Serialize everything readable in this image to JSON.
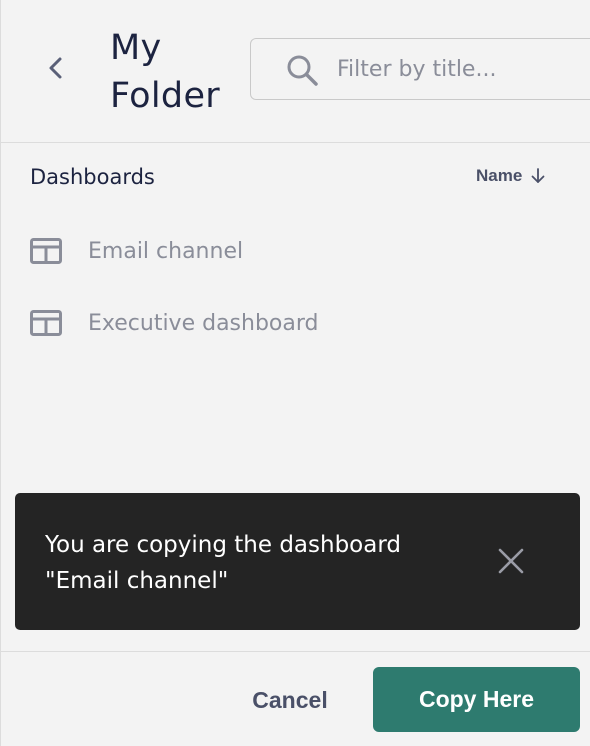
{
  "header": {
    "back_icon": "chevron-left-icon",
    "title": "My Folder",
    "search": {
      "icon": "search-icon",
      "placeholder": "Filter by title...",
      "value": ""
    }
  },
  "list": {
    "heading": "Dashboards",
    "sort": {
      "label": "Name",
      "icon": "arrow-down-icon"
    },
    "items": [
      {
        "label": "Email channel",
        "icon": "dashboard-icon"
      },
      {
        "label": "Executive dashboard",
        "icon": "dashboard-icon"
      }
    ]
  },
  "toast": {
    "message_line1": "You are copying the dashboard",
    "message_line2": "\"Email channel\"",
    "close_icon": "close-icon"
  },
  "footer": {
    "cancel_label": "Cancel",
    "copy_label": "Copy Here"
  },
  "colors": {
    "background": "#f3f3f3",
    "title_text": "#1c2340",
    "muted_text": "#8a8d99",
    "toast_background": "#242424",
    "primary_button": "#2e7b6f"
  }
}
